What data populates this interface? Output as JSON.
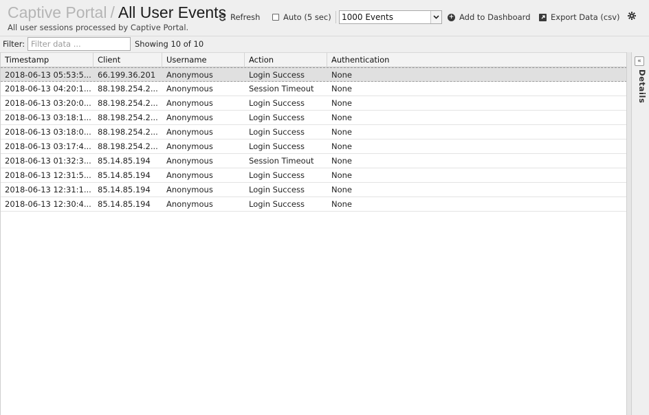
{
  "header": {
    "breadcrumb_root": "Captive Portal",
    "separator": "/",
    "title": "All User Events",
    "subtitle": "All user sessions processed by Captive Portal."
  },
  "toolbar": {
    "refresh_label": "Refresh",
    "auto_label": "Auto (5 sec)",
    "auto_checked": false,
    "events_select_value": "1000 Events",
    "add_dashboard_label": "Add to Dashboard",
    "export_label": "Export Data (csv)",
    "icons": {
      "refresh": "refresh-icon",
      "add": "plus-circle-icon",
      "export": "external-link-icon",
      "settings": "gear-icon"
    }
  },
  "filter": {
    "label": "Filter:",
    "placeholder": "Filter data ...",
    "value": "",
    "showing": "Showing 10 of 10"
  },
  "table": {
    "columns": [
      "Timestamp",
      "Client",
      "Username",
      "Action",
      "Authentication"
    ],
    "rows": [
      [
        "2018-06-13 05:53:5...",
        "66.199.36.201",
        "Anonymous",
        "Login Success",
        "None"
      ],
      [
        "2018-06-13 04:20:1...",
        "88.198.254.2...",
        "Anonymous",
        "Session Timeout",
        "None"
      ],
      [
        "2018-06-13 03:20:0...",
        "88.198.254.2...",
        "Anonymous",
        "Login Success",
        "None"
      ],
      [
        "2018-06-13 03:18:1...",
        "88.198.254.2...",
        "Anonymous",
        "Login Success",
        "None"
      ],
      [
        "2018-06-13 03:18:0...",
        "88.198.254.2...",
        "Anonymous",
        "Login Success",
        "None"
      ],
      [
        "2018-06-13 03:17:4...",
        "88.198.254.2...",
        "Anonymous",
        "Login Success",
        "None"
      ],
      [
        "2018-06-13 01:32:3...",
        "85.14.85.194",
        "Anonymous",
        "Session Timeout",
        "None"
      ],
      [
        "2018-06-13 12:31:5...",
        "85.14.85.194",
        "Anonymous",
        "Login Success",
        "None"
      ],
      [
        "2018-06-13 12:31:1...",
        "85.14.85.194",
        "Anonymous",
        "Login Success",
        "None"
      ],
      [
        "2018-06-13 12:30:4...",
        "85.14.85.194",
        "Anonymous",
        "Login Success",
        "None"
      ]
    ]
  },
  "details_panel": {
    "label": "Details",
    "collapse_icon": "double-chevron-left-icon"
  },
  "colors": {
    "header_bg": "#efefef",
    "selected_row_bg": "#e0e0e0",
    "breadcrumb_muted": "#b5b5b5"
  }
}
